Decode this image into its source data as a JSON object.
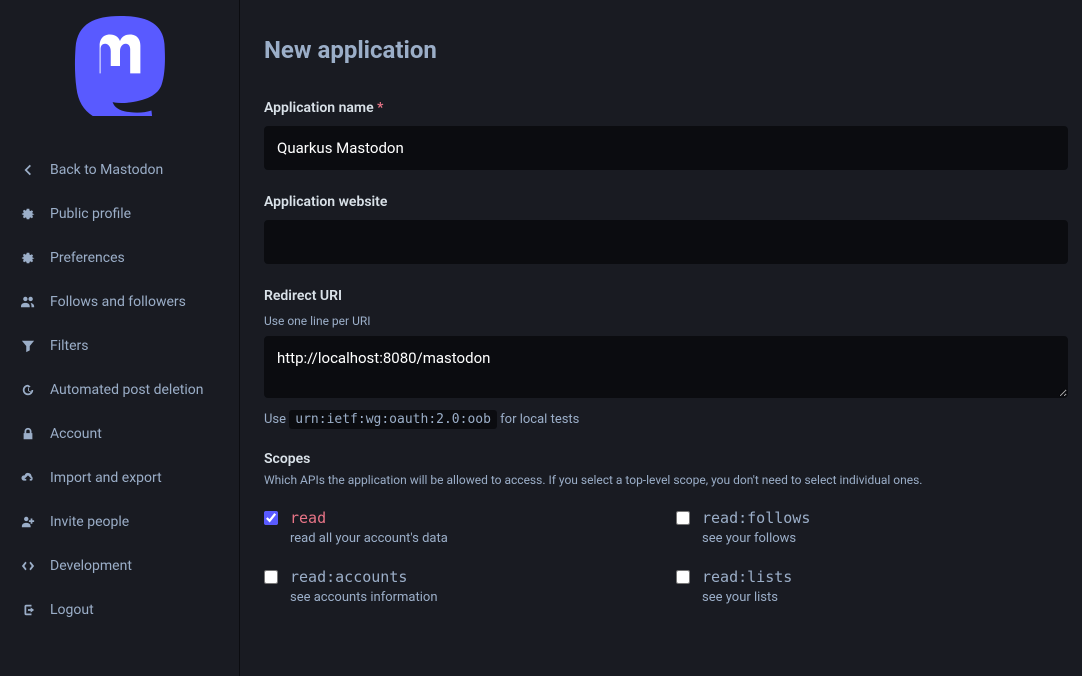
{
  "sidebar": {
    "items": [
      {
        "label": "Back to Mastodon",
        "icon": "chevron-left-icon"
      },
      {
        "label": "Public profile",
        "icon": "gear-icon"
      },
      {
        "label": "Preferences",
        "icon": "gear-icon"
      },
      {
        "label": "Follows and followers",
        "icon": "users-icon"
      },
      {
        "label": "Filters",
        "icon": "filter-icon"
      },
      {
        "label": "Automated post deletion",
        "icon": "history-icon"
      },
      {
        "label": "Account",
        "icon": "lock-icon"
      },
      {
        "label": "Import and export",
        "icon": "cloud-download-icon"
      },
      {
        "label": "Invite people",
        "icon": "user-plus-icon"
      },
      {
        "label": "Development",
        "icon": "code-icon"
      },
      {
        "label": "Logout",
        "icon": "sign-out-icon"
      }
    ]
  },
  "page": {
    "title": "New application"
  },
  "form": {
    "app_name_label": "Application name",
    "app_name_value": "Quarkus Mastodon",
    "app_website_label": "Application website",
    "app_website_value": "",
    "redirect_label": "Redirect URI",
    "redirect_hint": "Use one line per URI",
    "redirect_value": "http://localhost:8080/mastodon",
    "oob_pre": "Use ",
    "oob_code": "urn:ietf:wg:oauth:2.0:oob",
    "oob_post": " for local tests",
    "scopes_label": "Scopes",
    "scopes_hint": "Which APIs the application will be allowed to access. If you select a top-level scope, you don't need to select individual ones."
  },
  "scopes": {
    "left": [
      {
        "name": "read",
        "desc": "read all your account's data",
        "checked": true
      },
      {
        "name": "read:accounts",
        "desc": "see accounts information",
        "checked": false
      }
    ],
    "right": [
      {
        "name": "read:follows",
        "desc": "see your follows",
        "checked": false
      },
      {
        "name": "read:lists",
        "desc": "see your lists",
        "checked": false
      }
    ]
  }
}
